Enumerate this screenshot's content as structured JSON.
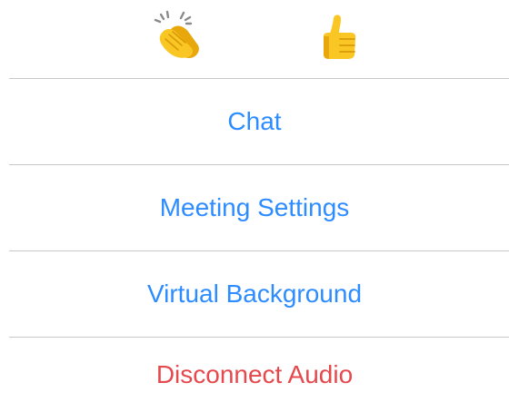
{
  "reactions": [
    {
      "icon": "clapping-hands-icon"
    },
    {
      "icon": "thumbs-up-icon"
    }
  ],
  "menu": {
    "chat_label": "Chat",
    "meeting_settings_label": "Meeting Settings",
    "virtual_background_label": "Virtual Background",
    "disconnect_audio_label": "Disconnect Audio"
  },
  "colors": {
    "action": "#2d8cff",
    "destructive": "#e5484d",
    "separator": "#c8c7cc",
    "emoji": "#f9c623"
  }
}
